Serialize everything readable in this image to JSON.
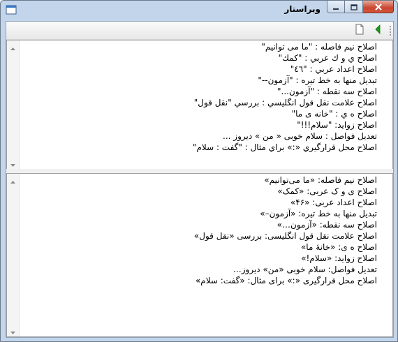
{
  "window": {
    "title": "ویراستار",
    "icon": "app-window-icon"
  },
  "caption_buttons": {
    "minimize_icon": "minimize-icon",
    "maximize_icon": "maximize-icon",
    "close_icon": "close-icon"
  },
  "toolbar": {
    "new_icon": "new-document-icon",
    "run_icon": "green-play-left-icon"
  },
  "input_editor": {
    "lines": [
      "اصلاح نیم فاصله : \"ما می توانیم\"",
      "اصلاح ي و ك عربي : \"كمك\"",
      "اصلاح اعداد عربي : \"٤٦\"",
      "تبدیل منها به خط تیره : \"آزمون--\"",
      "اصلاح سه نقطه : \"آزمون...\"",
      "اصلاح علامت نقل قول انگلیسي : بررسي \"نقل قول\"",
      "اصلاح ه ي : \"خانه ی ما\"",
      "اصلاح زواید: \"سلام!!!\"",
      "تعدیل فواصل : سلام   خوبی   «  من »   دیروز ...",
      "اصلاح محل قرارگیري «:» براي مثال : \"گفت : سلام\""
    ]
  },
  "output_editor": {
    "lines": [
      "اصلاح نیم فاصله: «ما می‌توانیم»",
      "اصلاح ی و ک عربی: «کمک»",
      "اصلاح اعداد عربی: «۴۶»",
      "تبدیل منها به خط تیره: «آزمون–»",
      "اصلاح سه نقطه: «آزمون…»",
      "اصلاح علامت نقل قول انگلیسی: بررسی «نقل قول»",
      "اصلاح ه ی: «خانهٔ ما»",
      "اصلاح زواید: «سلام!»",
      "تعدیل فواصل: سلام خوبی «من» دیروز…",
      "اصلاح محل قرارگیری «:» برای مثال: «گفت: سلام»"
    ]
  }
}
